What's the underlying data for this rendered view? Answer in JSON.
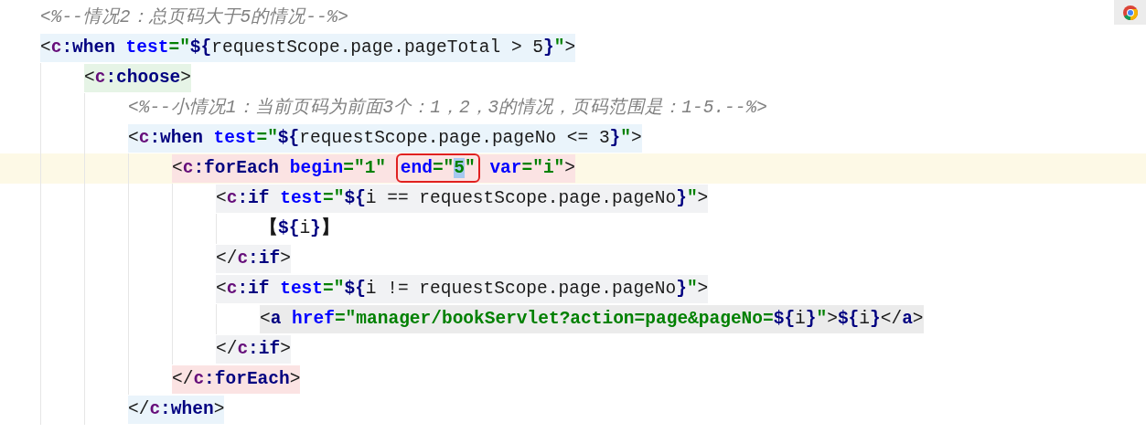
{
  "editor": {
    "lines": [
      {
        "kind": "comment",
        "current": false,
        "tokens": [
          {
            "kind": "comment",
            "text": "<%--情况2：总页码大于5的情况--%>"
          }
        ]
      },
      {
        "kind": "when",
        "current": false,
        "tokens": [
          {
            "kind": "punct",
            "text": "<"
          },
          {
            "kind": "ns",
            "text": "c"
          },
          {
            "kind": "tag",
            "text": ":when"
          },
          {
            "kind": "attr",
            "text": " test"
          },
          {
            "kind": "string",
            "text": "=\""
          },
          {
            "kind": "elbrace",
            "text": "${"
          },
          {
            "kind": "el",
            "text": "requestScope.page.pageTotal > 5"
          },
          {
            "kind": "elbrace",
            "text": "}"
          },
          {
            "kind": "string",
            "text": "\""
          },
          {
            "kind": "punct",
            "text": ">"
          }
        ],
        "children": [
          {
            "kind": "choose",
            "current": false,
            "tokens": [
              {
                "kind": "punct",
                "text": "<"
              },
              {
                "kind": "ns",
                "text": "c"
              },
              {
                "kind": "tag",
                "text": ":choose"
              },
              {
                "kind": "punct",
                "text": ">"
              }
            ],
            "children": [
              {
                "kind": "comment",
                "current": false,
                "tokens": [
                  {
                    "kind": "comment",
                    "text": "<%--小情况1：当前页码为前面3个：1，2，3的情况，页码范围是：1-5.--%>"
                  }
                ]
              },
              {
                "kind": "when",
                "current": false,
                "tokens": [
                  {
                    "kind": "punct",
                    "text": "<"
                  },
                  {
                    "kind": "ns",
                    "text": "c"
                  },
                  {
                    "kind": "tag",
                    "text": ":when"
                  },
                  {
                    "kind": "attr",
                    "text": " test"
                  },
                  {
                    "kind": "string",
                    "text": "=\""
                  },
                  {
                    "kind": "elbrace",
                    "text": "${"
                  },
                  {
                    "kind": "el",
                    "text": "requestScope.page.pageNo <= 3"
                  },
                  {
                    "kind": "elbrace",
                    "text": "}"
                  },
                  {
                    "kind": "string",
                    "text": "\""
                  },
                  {
                    "kind": "punct",
                    "text": ">"
                  }
                ],
                "children": [
                  {
                    "kind": "foreach",
                    "current": true,
                    "tokens": [
                      {
                        "kind": "punct",
                        "text": "<"
                      },
                      {
                        "kind": "ns",
                        "text": "c"
                      },
                      {
                        "kind": "tag",
                        "text": ":forEach"
                      },
                      {
                        "kind": "attr",
                        "text": " begin"
                      },
                      {
                        "kind": "string",
                        "text": "=\"1\" "
                      },
                      {
                        "kind": "boxed",
                        "tokens": [
                          {
                            "kind": "attr",
                            "text": "end"
                          },
                          {
                            "kind": "string",
                            "text": "=\""
                          },
                          {
                            "kind": "selection",
                            "text": "5"
                          },
                          {
                            "kind": "string",
                            "text": "\""
                          }
                        ]
                      },
                      {
                        "kind": "attr",
                        "text": " var"
                      },
                      {
                        "kind": "string",
                        "text": "=\"i\""
                      },
                      {
                        "kind": "punct",
                        "text": ">"
                      }
                    ],
                    "children": [
                      {
                        "kind": "if",
                        "current": false,
                        "tokens": [
                          {
                            "kind": "punct",
                            "text": "<"
                          },
                          {
                            "kind": "ns",
                            "text": "c"
                          },
                          {
                            "kind": "tag",
                            "text": ":if"
                          },
                          {
                            "kind": "attr",
                            "text": " test"
                          },
                          {
                            "kind": "string",
                            "text": "=\""
                          },
                          {
                            "kind": "elbrace",
                            "text": "${"
                          },
                          {
                            "kind": "el",
                            "text": "i == requestScope.page.pageNo"
                          },
                          {
                            "kind": "elbrace",
                            "text": "}"
                          },
                          {
                            "kind": "string",
                            "text": "\""
                          },
                          {
                            "kind": "punct",
                            "text": ">"
                          }
                        ],
                        "children": [
                          {
                            "kind": "text",
                            "current": false,
                            "tokens": [
                              {
                                "kind": "text",
                                "text": "【"
                              },
                              {
                                "kind": "elbrace",
                                "text": "${"
                              },
                              {
                                "kind": "el",
                                "text": "i"
                              },
                              {
                                "kind": "elbrace",
                                "text": "}"
                              },
                              {
                                "kind": "text",
                                "text": "】"
                              }
                            ]
                          }
                        ]
                      },
                      {
                        "kind": "if",
                        "current": false,
                        "tokens": [
                          {
                            "kind": "punct",
                            "text": "</"
                          },
                          {
                            "kind": "ns",
                            "text": "c"
                          },
                          {
                            "kind": "tag",
                            "text": ":if"
                          },
                          {
                            "kind": "punct",
                            "text": ">"
                          }
                        ]
                      },
                      {
                        "kind": "if",
                        "current": false,
                        "tokens": [
                          {
                            "kind": "punct",
                            "text": "<"
                          },
                          {
                            "kind": "ns",
                            "text": "c"
                          },
                          {
                            "kind": "tag",
                            "text": ":if"
                          },
                          {
                            "kind": "attr",
                            "text": " test"
                          },
                          {
                            "kind": "string",
                            "text": "=\""
                          },
                          {
                            "kind": "elbrace",
                            "text": "${"
                          },
                          {
                            "kind": "el",
                            "text": "i != requestScope.page.pageNo"
                          },
                          {
                            "kind": "elbrace",
                            "text": "}"
                          },
                          {
                            "kind": "string",
                            "text": "\""
                          },
                          {
                            "kind": "punct",
                            "text": ">"
                          }
                        ],
                        "children": [
                          {
                            "kind": "a",
                            "current": false,
                            "tokens": [
                              {
                                "kind": "punct",
                                "text": "<"
                              },
                              {
                                "kind": "tag",
                                "text": "a"
                              },
                              {
                                "kind": "attr",
                                "text": " href"
                              },
                              {
                                "kind": "string",
                                "text": "=\"manager/bookServlet?action=page&pageNo="
                              },
                              {
                                "kind": "elbrace",
                                "text": "${"
                              },
                              {
                                "kind": "el",
                                "text": "i"
                              },
                              {
                                "kind": "elbrace",
                                "text": "}"
                              },
                              {
                                "kind": "string",
                                "text": "\""
                              },
                              {
                                "kind": "punct",
                                "text": ">"
                              },
                              {
                                "kind": "elbrace",
                                "text": "${"
                              },
                              {
                                "kind": "el",
                                "text": "i"
                              },
                              {
                                "kind": "elbrace",
                                "text": "}"
                              },
                              {
                                "kind": "punct",
                                "text": "</"
                              },
                              {
                                "kind": "tag",
                                "text": "a"
                              },
                              {
                                "kind": "punct",
                                "text": ">"
                              }
                            ]
                          }
                        ]
                      },
                      {
                        "kind": "if",
                        "current": false,
                        "tokens": [
                          {
                            "kind": "punct",
                            "text": "</"
                          },
                          {
                            "kind": "ns",
                            "text": "c"
                          },
                          {
                            "kind": "tag",
                            "text": ":if"
                          },
                          {
                            "kind": "punct",
                            "text": ">"
                          }
                        ]
                      }
                    ]
                  },
                  {
                    "kind": "foreach",
                    "current": false,
                    "tokens": [
                      {
                        "kind": "punct",
                        "text": "</"
                      },
                      {
                        "kind": "ns",
                        "text": "c"
                      },
                      {
                        "kind": "tag",
                        "text": ":forEach"
                      },
                      {
                        "kind": "punct",
                        "text": ">"
                      }
                    ]
                  }
                ]
              },
              {
                "kind": "when",
                "current": false,
                "tokens": [
                  {
                    "kind": "punct",
                    "text": "</"
                  },
                  {
                    "kind": "ns",
                    "text": "c"
                  },
                  {
                    "kind": "tag",
                    "text": ":when"
                  },
                  {
                    "kind": "punct",
                    "text": ">"
                  }
                ]
              }
            ]
          }
        ]
      }
    ]
  }
}
